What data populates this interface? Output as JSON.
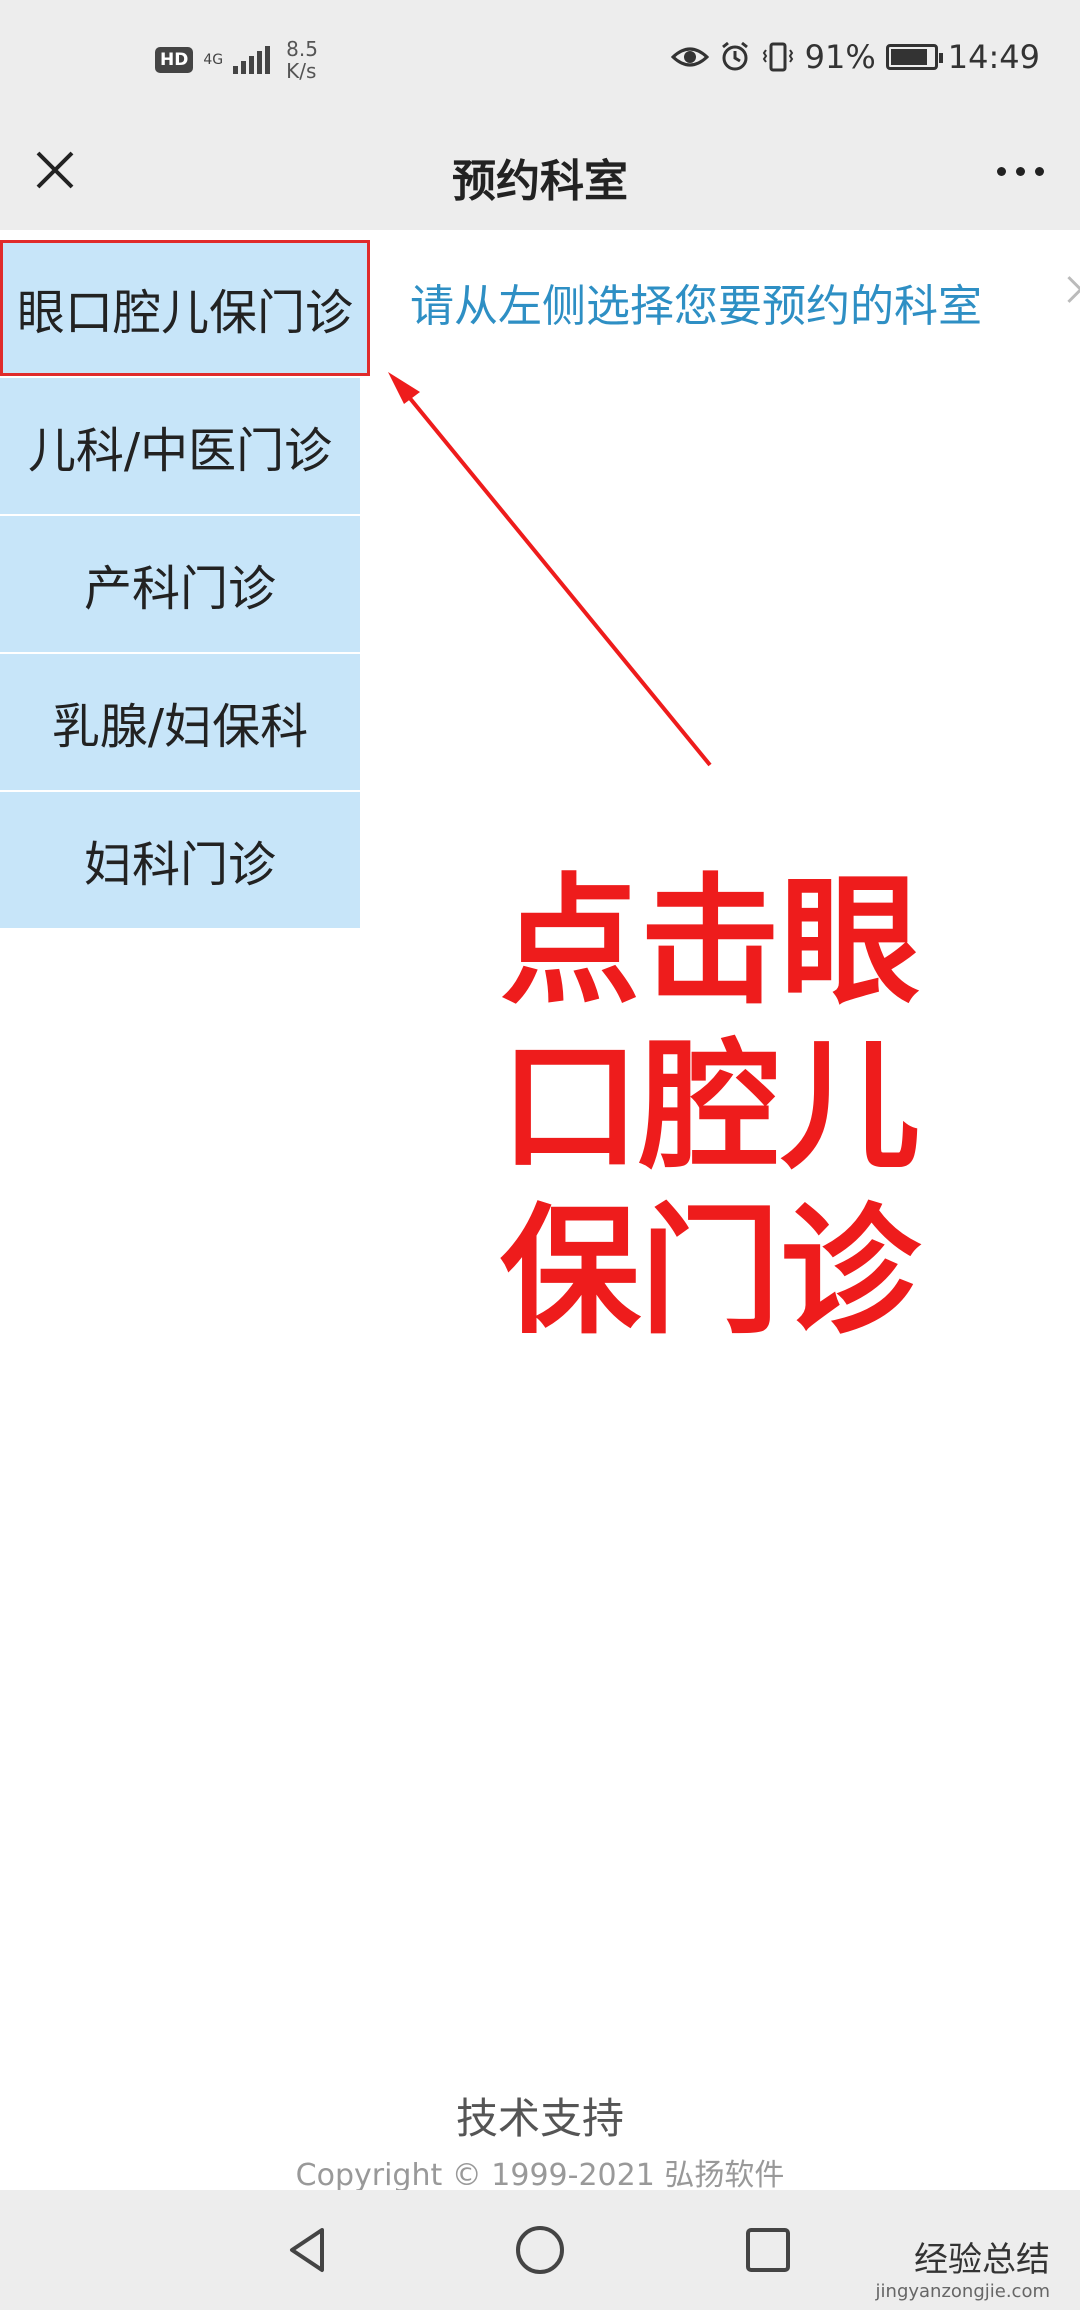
{
  "status_bar": {
    "hd": "HD",
    "network": "4G",
    "speed_value": "8.5",
    "speed_unit": "K/s",
    "battery_percent": "91%",
    "battery_level": 0.91,
    "time": "14:49"
  },
  "nav": {
    "title": "预约科室"
  },
  "departments": [
    {
      "label": "眼口腔儿保门诊"
    },
    {
      "label": "儿科/中医门诊"
    },
    {
      "label": "产科门诊"
    },
    {
      "label": "乳腺/妇保科"
    },
    {
      "label": "妇科门诊"
    }
  ],
  "hint": "请从左侧选择您要预约的科室",
  "annotation": {
    "text": "点击眼口腔儿保门诊",
    "color": "#ee1c1c"
  },
  "footer": {
    "support": "技术支持",
    "copyright": "Copyright © 1999-2021 弘扬软件"
  },
  "watermark": {
    "main": "经验总结",
    "url": "jingyanzongjie.com"
  },
  "colors": {
    "list_bg": "#c7e5f9",
    "hint_text": "#2e8fc4",
    "highlight_border": "#e02b2b"
  }
}
